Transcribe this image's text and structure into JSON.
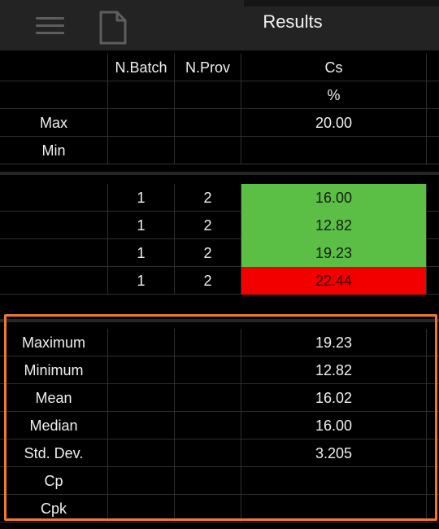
{
  "header": {
    "title": "Results",
    "menu_icon": "hamburger-menu-icon",
    "doc_icon": "document-icon"
  },
  "columns": [
    "",
    "N.Batch",
    "N.Prov",
    "Cs"
  ],
  "spec": {
    "unit": "%",
    "max_label": "Max",
    "max_value": "20.00",
    "min_label": "Min",
    "min_value": ""
  },
  "results": [
    {
      "batch": "1",
      "prov": "2",
      "cs": "16.00",
      "status": "ok"
    },
    {
      "batch": "1",
      "prov": "2",
      "cs": "12.82",
      "status": "ok"
    },
    {
      "batch": "1",
      "prov": "2",
      "cs": "19.23",
      "status": "ok"
    },
    {
      "batch": "1",
      "prov": "2",
      "cs": "22.44",
      "status": "out-of-spec"
    }
  ],
  "stats": [
    {
      "label": "Maximum",
      "value": "19.23"
    },
    {
      "label": "Minimum",
      "value": "12.82"
    },
    {
      "label": "Mean",
      "value": "16.02"
    },
    {
      "label": "Median",
      "value": "16.00"
    },
    {
      "label": "Std. Dev.",
      "value": "3.205"
    },
    {
      "label": "Cp",
      "value": ""
    },
    {
      "label": "Cpk",
      "value": ""
    }
  ],
  "colors": {
    "ok": "#5bbf46",
    "out_of_spec": "#f20000",
    "highlight": "#ef7a2c"
  }
}
